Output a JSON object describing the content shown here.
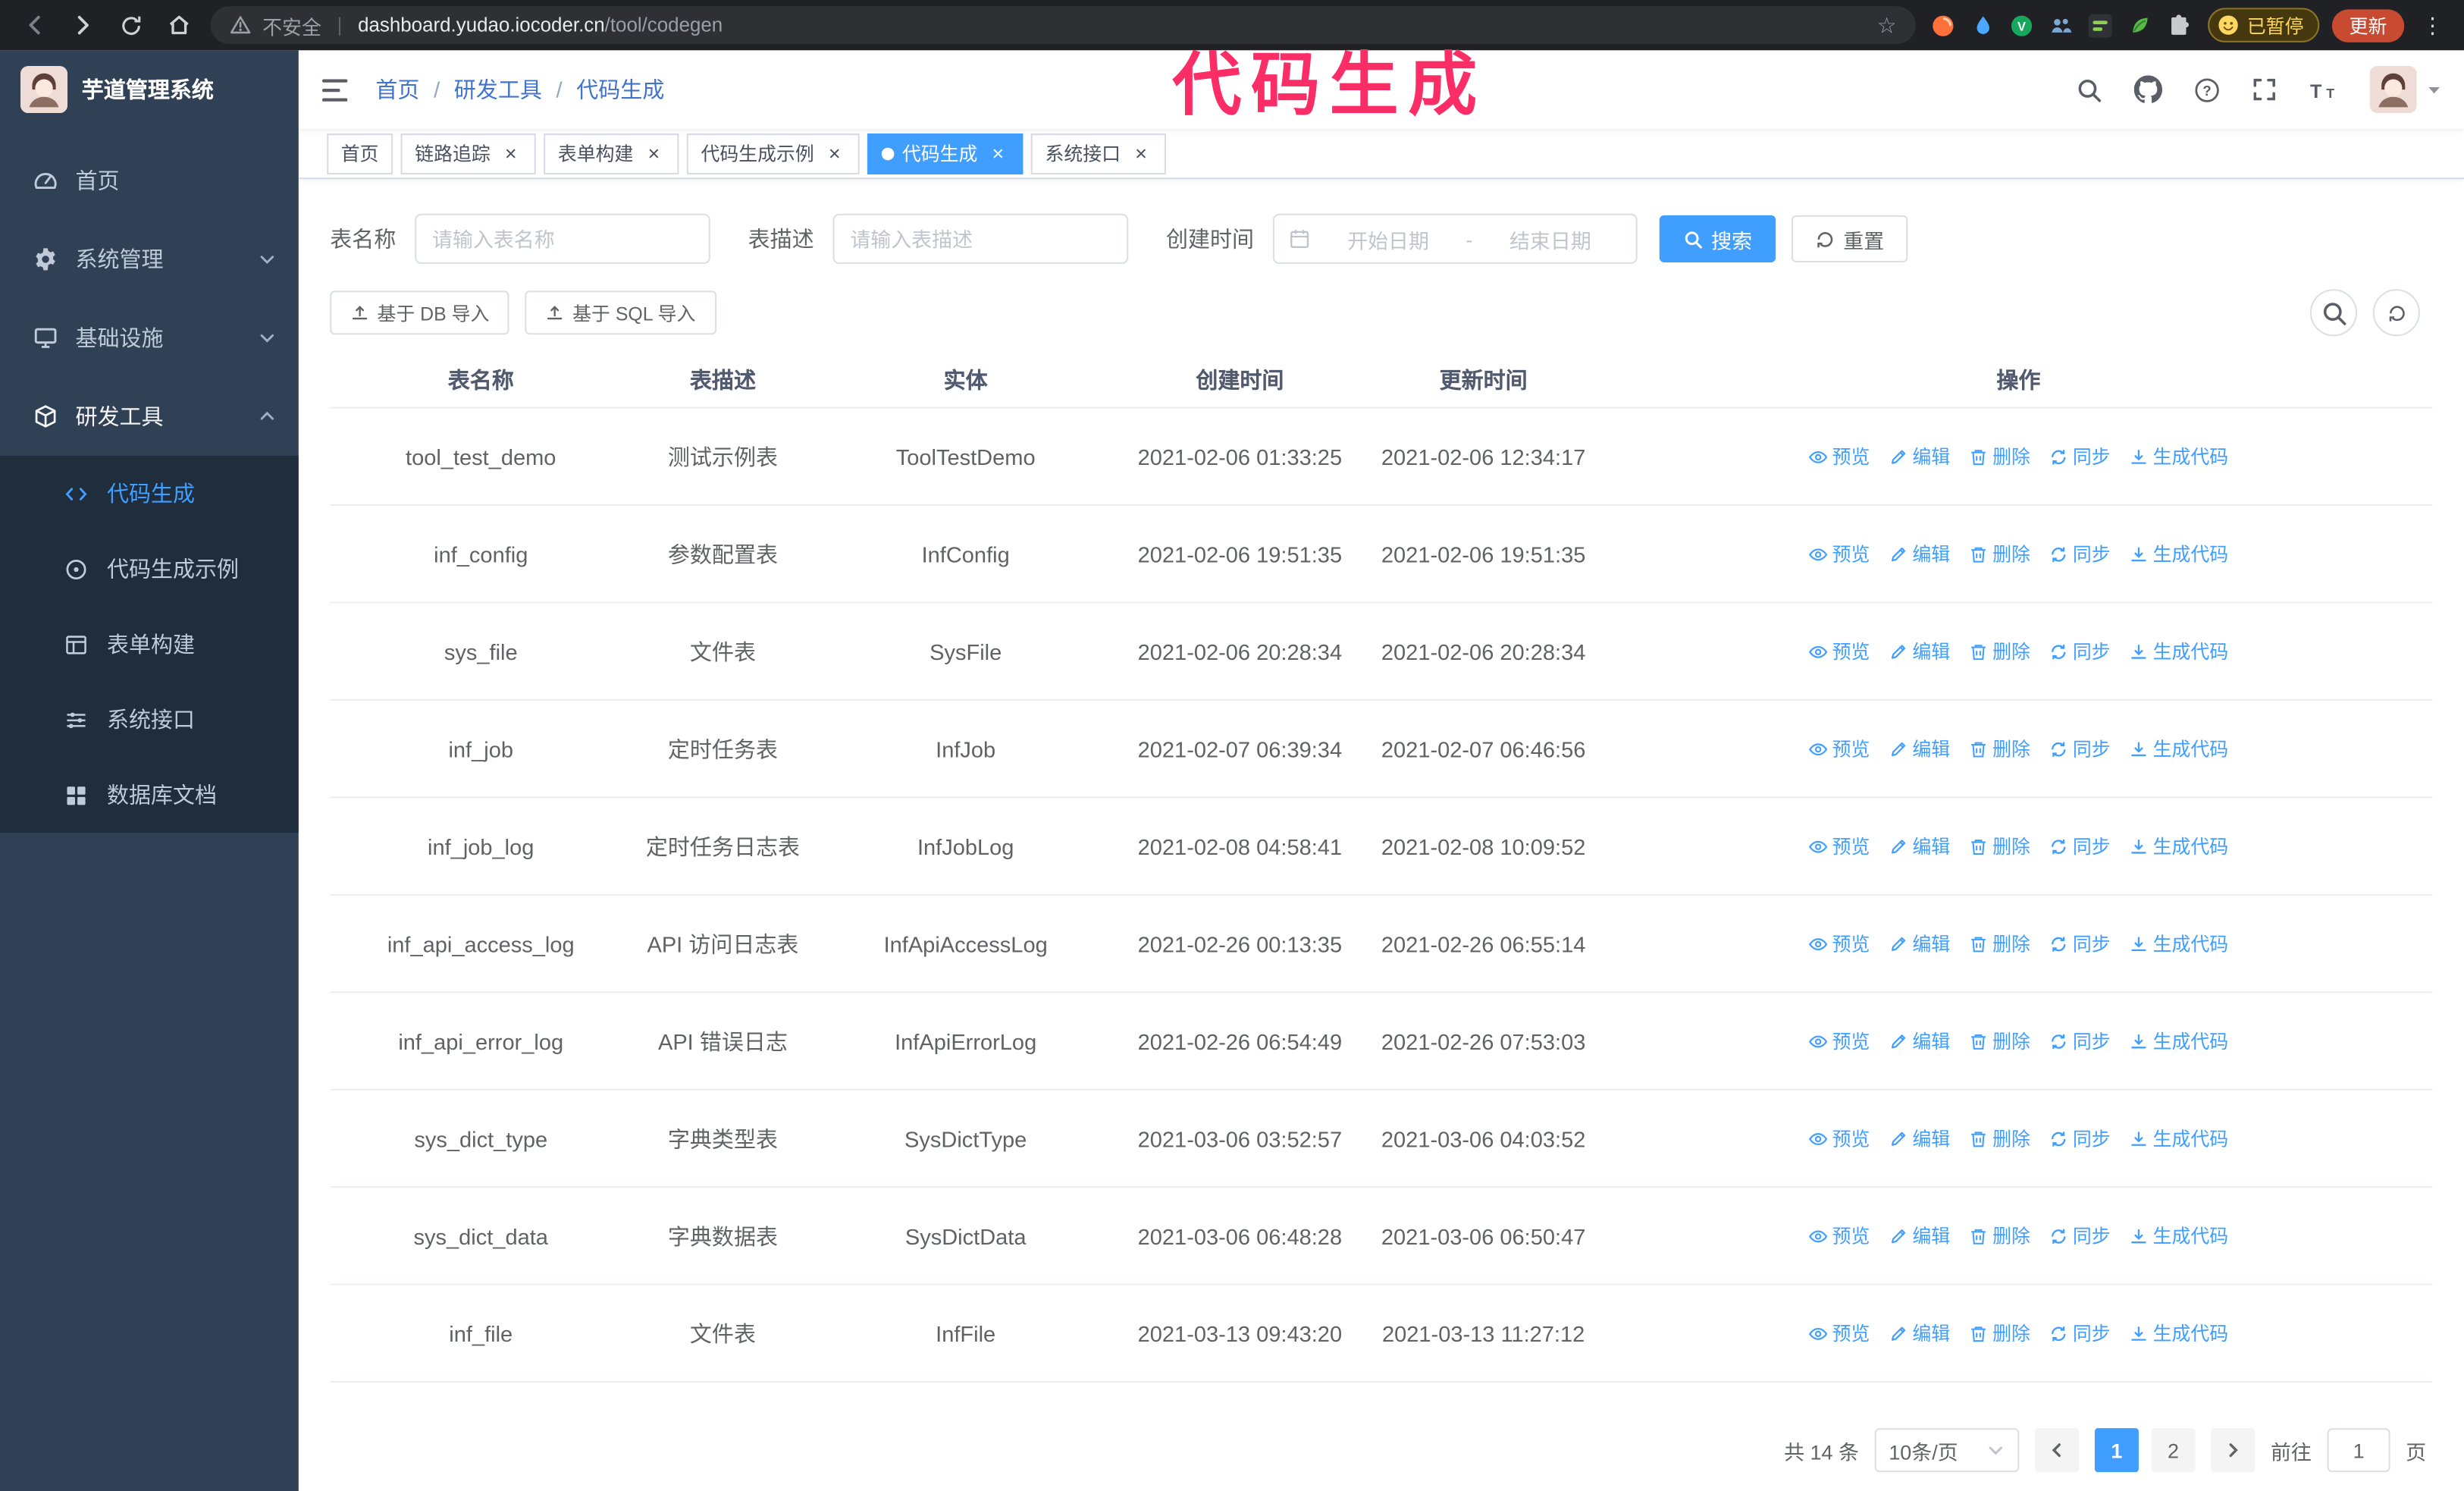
{
  "annotation": {
    "text": "代码生成",
    "color": "#fb2d66"
  },
  "browser": {
    "security_label": "不安全",
    "url_domain": "dashboard.yudao.iocoder.cn",
    "url_path": "/tool/codegen",
    "paused_badge": "已暂停",
    "update_button": "更新",
    "nav": [
      {
        "name": "back-icon",
        "icon": "arrow-left",
        "dim": true
      },
      {
        "name": "forward-icon",
        "icon": "arrow-right",
        "dim": false
      },
      {
        "name": "reload-icon",
        "icon": "reload",
        "dim": false
      },
      {
        "name": "home-icon",
        "icon": "home",
        "dim": false
      }
    ],
    "extensions": [
      {
        "name": "orange-extension-icon",
        "icon": "ext-orange",
        "color": "#ff7139"
      },
      {
        "name": "water-drop-extension-icon",
        "icon": "ext-drop",
        "color": "#4aa8ff"
      },
      {
        "name": "vimium-extension-icon",
        "icon": "ext-vimium",
        "color": "#16a75c"
      },
      {
        "name": "people-extension-icon",
        "icon": "ext-people",
        "color": "#7ba7d7"
      },
      {
        "name": "dark-extension-icon",
        "icon": "ext-dark",
        "color": "#2f3337"
      },
      {
        "name": "leaf-extension-icon",
        "icon": "ext-leaf",
        "color": "#57b846"
      },
      {
        "name": "puzzle-extensions-menu-icon",
        "icon": "ext-puzzle",
        "color": "#c8cbce"
      }
    ]
  },
  "sidebar": {
    "logo_title": "芋道管理系统",
    "items": [
      {
        "key": "home",
        "label": "首页",
        "icon": "dashboard-icon",
        "expandable": false,
        "expanded": false
      },
      {
        "key": "system",
        "label": "系统管理",
        "icon": "gear-icon",
        "expandable": true,
        "expanded": false
      },
      {
        "key": "infra",
        "label": "基础设施",
        "icon": "infra-icon",
        "expandable": true,
        "expanded": false
      },
      {
        "key": "dev-tools",
        "label": "研发工具",
        "icon": "tools-icon",
        "expandable": true,
        "expanded": true
      }
    ],
    "submenu": [
      {
        "key": "codegen",
        "label": "代码生成",
        "icon": "code-icon",
        "active": true
      },
      {
        "key": "codegen-example",
        "label": "代码生成示例",
        "icon": "example-icon",
        "active": false
      },
      {
        "key": "form-builder",
        "label": "表单构建",
        "icon": "form-icon",
        "active": false
      },
      {
        "key": "api",
        "label": "系统接口",
        "icon": "api-icon",
        "active": false
      },
      {
        "key": "db-doc",
        "label": "数据库文档",
        "icon": "dbdoc-icon",
        "active": false
      }
    ]
  },
  "header": {
    "breadcrumb": [
      "首页",
      "研发工具",
      "代码生成"
    ],
    "right_icons": [
      {
        "name": "search-icon",
        "icon": "mag"
      },
      {
        "name": "github-icon",
        "icon": "github"
      },
      {
        "name": "question-icon",
        "icon": "question"
      },
      {
        "name": "fullscreen-icon",
        "icon": "fullscreen"
      },
      {
        "name": "font-size-icon",
        "icon": "fontsize"
      }
    ]
  },
  "tabs": [
    {
      "key": "home",
      "label": "首页",
      "closable": false,
      "active": false
    },
    {
      "key": "trace",
      "label": "链路追踪",
      "closable": true,
      "active": false
    },
    {
      "key": "form-builder",
      "label": "表单构建",
      "closable": true,
      "active": false
    },
    {
      "key": "codegen-example",
      "label": "代码生成示例",
      "closable": true,
      "active": false
    },
    {
      "key": "codegen",
      "label": "代码生成",
      "closable": true,
      "active": true
    },
    {
      "key": "api",
      "label": "系统接口",
      "closable": true,
      "active": false
    }
  ],
  "filters": {
    "table_name": {
      "label": "表名称",
      "placeholder": "请输入表名称",
      "value": ""
    },
    "table_desc": {
      "label": "表描述",
      "placeholder": "请输入表描述",
      "value": ""
    },
    "create_time": {
      "label": "创建时间",
      "start_placeholder": "开始日期",
      "separator": "-",
      "end_placeholder": "结束日期"
    },
    "search_label": "搜索",
    "reset_label": "重置"
  },
  "toolbar": {
    "import_db": "基于 DB 导入",
    "import_sql": "基于 SQL 导入",
    "right_buttons": [
      {
        "name": "hide-search-button",
        "icon": "mag"
      },
      {
        "name": "refresh-table-button",
        "icon": "refresh"
      }
    ]
  },
  "table": {
    "columns": [
      "表名称",
      "表描述",
      "实体",
      "创建时间",
      "更新时间",
      "操作"
    ],
    "ops": [
      {
        "key": "preview",
        "label": "预览",
        "icon": "eye-icon"
      },
      {
        "key": "edit",
        "label": "编辑",
        "icon": "edit-icon"
      },
      {
        "key": "delete",
        "label": "删除",
        "icon": "delete-icon"
      },
      {
        "key": "sync",
        "label": "同步",
        "icon": "sync-icon"
      },
      {
        "key": "generate",
        "label": "生成代码",
        "icon": "download-icon"
      }
    ],
    "rows": [
      {
        "name": "tool_test_demo",
        "desc": "测试示例表",
        "entity": "ToolTestDemo",
        "created": "2021-02-06 01:33:25",
        "updated": "2021-02-06 12:34:17"
      },
      {
        "name": "inf_config",
        "desc": "参数配置表",
        "entity": "InfConfig",
        "created": "2021-02-06 19:51:35",
        "updated": "2021-02-06 19:51:35"
      },
      {
        "name": "sys_file",
        "desc": "文件表",
        "entity": "SysFile",
        "created": "2021-02-06 20:28:34",
        "updated": "2021-02-06 20:28:34"
      },
      {
        "name": "inf_job",
        "desc": "定时任务表",
        "entity": "InfJob",
        "created": "2021-02-07 06:39:34",
        "updated": "2021-02-07 06:46:56"
      },
      {
        "name": "inf_job_log",
        "desc": "定时任务日志表",
        "entity": "InfJobLog",
        "created": "2021-02-08 04:58:41",
        "updated": "2021-02-08 10:09:52"
      },
      {
        "name": "inf_api_access_log",
        "desc": "API 访问日志表",
        "entity": "InfApiAccessLog",
        "created": "2021-02-26 00:13:35",
        "updated": "2021-02-26 06:55:14"
      },
      {
        "name": "inf_api_error_log",
        "desc": "API 错误日志",
        "entity": "InfApiErrorLog",
        "created": "2021-02-26 06:54:49",
        "updated": "2021-02-26 07:53:03"
      },
      {
        "name": "sys_dict_type",
        "desc": "字典类型表",
        "entity": "SysDictType",
        "created": "2021-03-06 03:52:57",
        "updated": "2021-03-06 04:03:52"
      },
      {
        "name": "sys_dict_data",
        "desc": "字典数据表",
        "entity": "SysDictData",
        "created": "2021-03-06 06:48:28",
        "updated": "2021-03-06 06:50:47"
      },
      {
        "name": "inf_file",
        "desc": "文件表",
        "entity": "InfFile",
        "created": "2021-03-13 09:43:20",
        "updated": "2021-03-13 11:27:12"
      }
    ]
  },
  "pagination": {
    "total": "共 14 条",
    "page_size": "10条/页",
    "pages": [
      "1",
      "2"
    ],
    "active_page": "1",
    "goto": "前往",
    "goto_value": "1",
    "unit": "页"
  },
  "colors": {
    "accent": "#409eff",
    "sidebar_bg": "#304156",
    "submenu_bg": "#1f2d3d",
    "annotation": "#fb2d66",
    "chrome_bg": "#202124"
  }
}
